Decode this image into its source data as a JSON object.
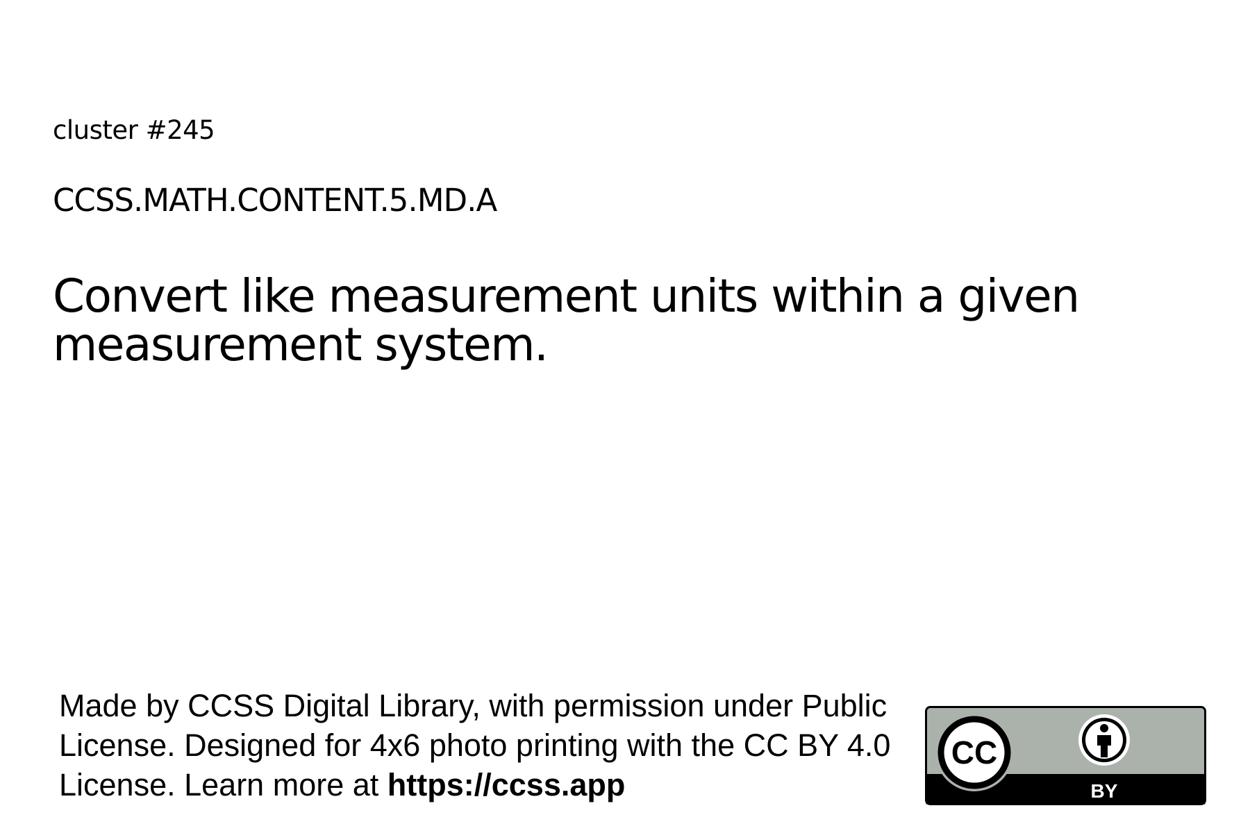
{
  "header": {
    "cluster_label": "cluster #245",
    "standard_code": "CCSS.MATH.CONTENT.5.MD.A"
  },
  "main": {
    "description": "Convert like measurement units within a given measurement system."
  },
  "footer": {
    "attribution_text": "Made by CCSS Digital Library, with permission under Public License. Designed for 4x6 photo printing with the CC BY 4.0 License. Learn more at",
    "link_text": "https://ccss.app",
    "license_badge": {
      "cc_text": "CC",
      "by_text": "BY",
      "icons": [
        "creative-commons-icon",
        "attribution-person-icon"
      ],
      "colors": {
        "badge_gray": "#aab2ab",
        "badge_black": "#000000",
        "badge_white": "#ffffff"
      }
    }
  }
}
